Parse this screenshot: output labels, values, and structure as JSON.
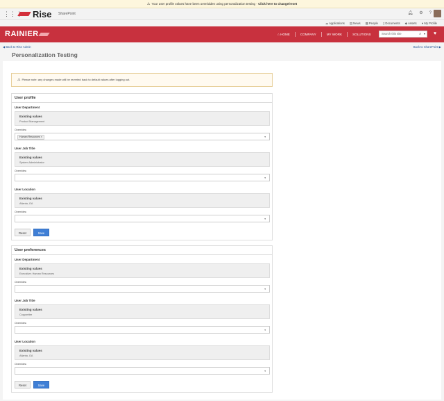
{
  "banner": {
    "text": "Your user profile values have been overridden using personalization testing · ",
    "link": "Click here to change/reset"
  },
  "suitebar": {
    "logo_text": "Rise",
    "app_name": "SharePoint",
    "icons": [
      "bell-icon",
      "gear-icon",
      "help-icon"
    ]
  },
  "quicklinks": [
    "Applications",
    "News",
    "People",
    "Documents",
    "Assets",
    "My Profile"
  ],
  "navbar": {
    "brand": "RAINIER",
    "links": [
      "HOME",
      "COMPANY",
      "MY WORK",
      "SOLUTIONS"
    ],
    "search_placeholder": "Search this site"
  },
  "subnav": {
    "back_left": "Back to Rise Admin",
    "back_right": "Back to SharePoint"
  },
  "page_title": "Personalization Testing",
  "notice": "Please note: any changes made will be reverted back to default values after logging out.",
  "labels": {
    "existing": "Existing values",
    "overrides": "Overrides:",
    "reset": "Reset",
    "save": "Save"
  },
  "user_profile": {
    "title": "User profile",
    "fields": [
      {
        "label": "User Department",
        "existing": "Product Management",
        "override_tag": "Human Resources ×"
      },
      {
        "label": "User Job Title",
        "existing": "System Administrator",
        "override_tag": ""
      },
      {
        "label": "User Location",
        "existing": "Atlanta, GA",
        "override_tag": ""
      }
    ]
  },
  "user_preferences": {
    "title": "User preferences",
    "fields": [
      {
        "label": "User Department",
        "existing": "Executive; Human Resources",
        "override_tag": ""
      },
      {
        "label": "User Job Title",
        "existing": "Copywriter",
        "override_tag": ""
      },
      {
        "label": "User Location",
        "existing": "Atlanta, GA",
        "override_tag": ""
      }
    ]
  }
}
